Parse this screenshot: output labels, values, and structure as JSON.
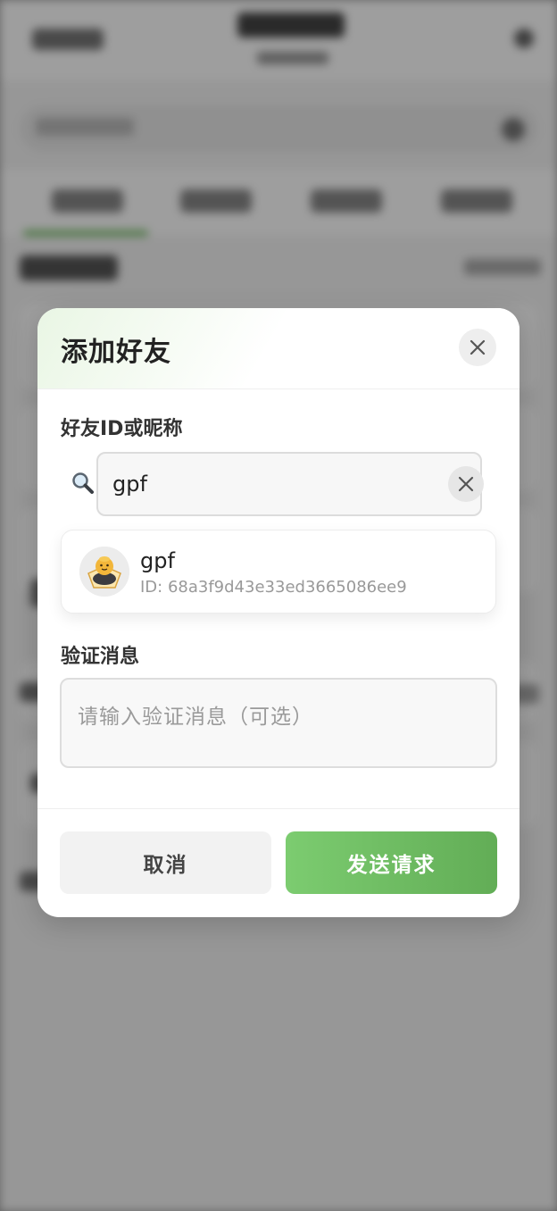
{
  "dialog": {
    "title": "添加好友",
    "close_icon": "close-icon",
    "friend_field": {
      "label": "好友ID或昵称",
      "value": "gpf",
      "lead_icon": "magnifier-icon",
      "clear_icon": "clear-icon"
    },
    "search_result": {
      "name": "gpf",
      "id": "ID: 68a3f9d43e33ed3665086ee9",
      "avatar_icon": "avatar-icon"
    },
    "message_field": {
      "label": "验证消息",
      "placeholder": "请输入验证消息（可选）"
    },
    "buttons": {
      "cancel": "取消",
      "send": "发送请求"
    }
  },
  "colors": {
    "primary": "#6dbb5e",
    "overlay": "rgba(0,0,0,0.38)"
  }
}
